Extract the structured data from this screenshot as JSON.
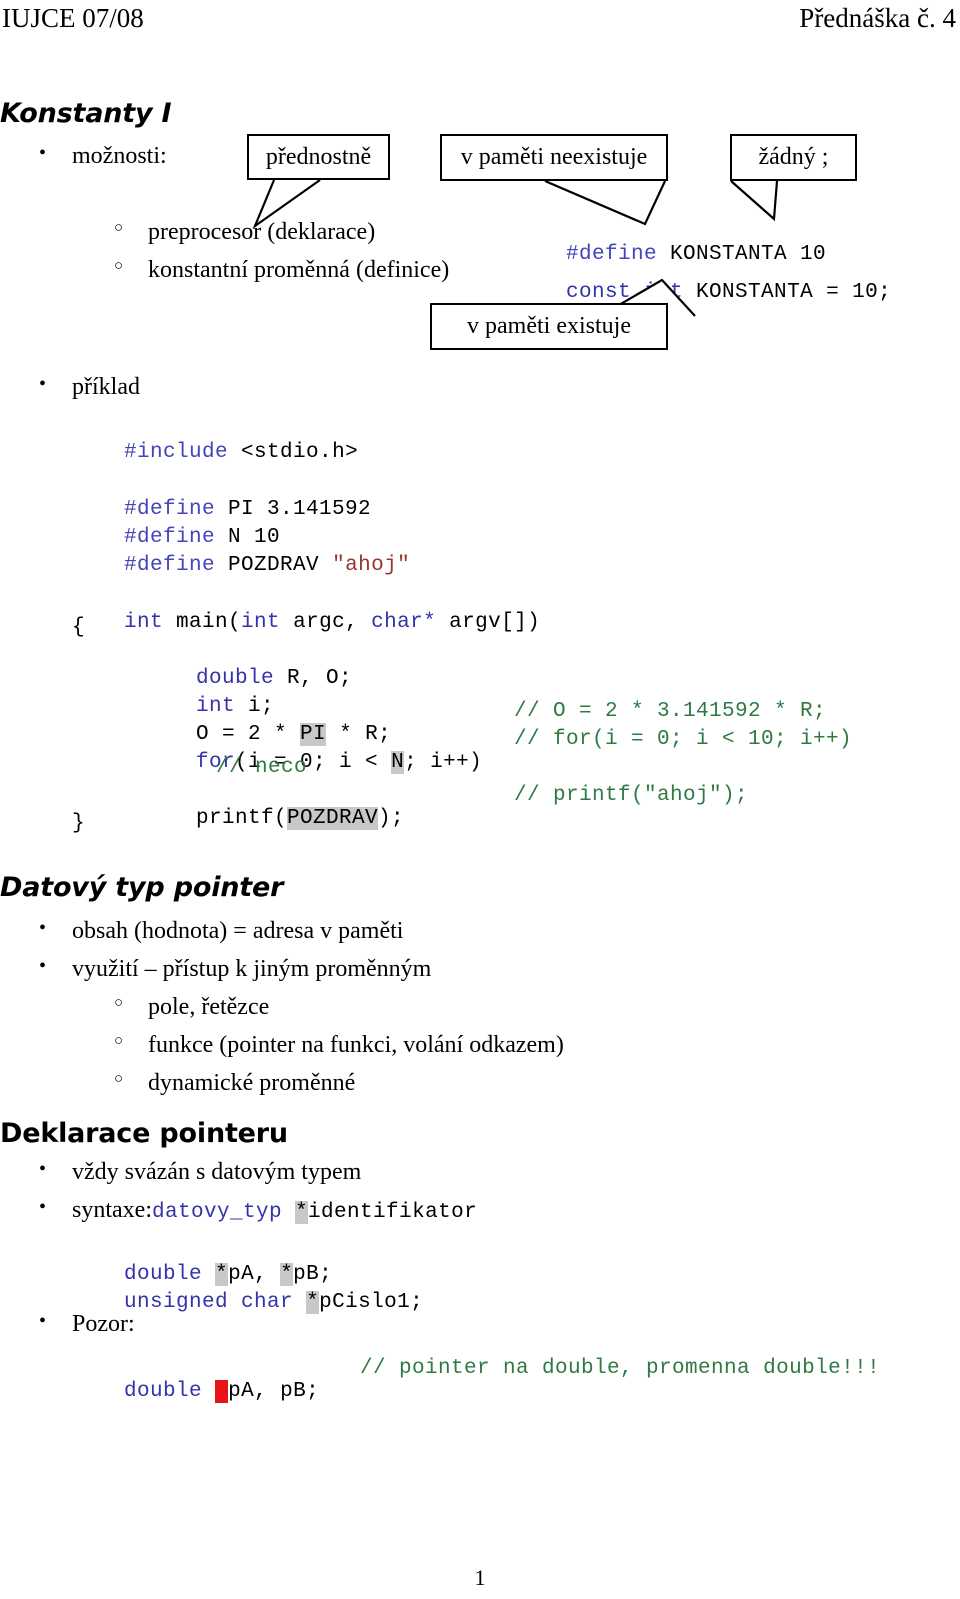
{
  "header": {
    "left": "IUJCE 07/08",
    "right": "Přednáška č. 4"
  },
  "sections": {
    "konstanty": "Konstanty I",
    "pointer": "Datový typ pointer",
    "deklarace": "Deklarace pointeru"
  },
  "konstanty": {
    "moznosti_label": "možnosti:",
    "items": [
      {
        "text": "preprocesor (deklarace)"
      },
      {
        "text": "konstantní proměnná (definice)"
      }
    ],
    "code": {
      "define_kw": "#define",
      "define_rest": " KONSTANTA 10",
      "const_kw": "const int",
      "const_rest": " KONSTANTA = 10;"
    },
    "callouts": [
      {
        "id": "prednostne",
        "text": "přednostně"
      },
      {
        "id": "neexistuje",
        "text": "v paměti neexistuje"
      },
      {
        "id": "zadny",
        "text": "žádný ;"
      },
      {
        "id": "existuje",
        "text": "v paměti existuje"
      }
    ],
    "priklad_label": "příklad"
  },
  "example_code": {
    "include": {
      "pp": "#include",
      "rest": " <stdio.h>"
    },
    "define_pi": {
      "pp": "#define",
      "rest": " PI 3.141592"
    },
    "define_n": {
      "pp": "#define",
      "rest": " N 10"
    },
    "define_pozdrav": {
      "pp": "#define",
      "mid": " POZDRAV ",
      "str": "\"ahoj\""
    },
    "main_sig": {
      "kw1": "int",
      "mid1": " main(",
      "kw2": "int",
      "mid2": " argc, ",
      "kw3": "char*",
      "mid3": " argv[])"
    },
    "brace_open": "{",
    "double_decl": {
      "kw": "double",
      "rest": " R, O;"
    },
    "int_decl": {
      "kw": "int",
      "rest": " i;"
    },
    "o_assign": {
      "pre": "O = 2 * ",
      "hl": "PI",
      "post": " * R;"
    },
    "for_line": {
      "kw": "for",
      "pre": "(i = 0; i < ",
      "hl": "N",
      "post": "; i++)"
    },
    "neco_comment": "// neco",
    "printf_line": {
      "pre": "printf(",
      "hl": "POZDRAV",
      "post": ");"
    },
    "brace_close": "}",
    "comments": {
      "o_assign": "// O = 2 * 3.141592 * R;",
      "for_line": "// for(i = 0; i < 10; i++)",
      "printf_line": "// printf(\"ahoj\");"
    }
  },
  "pointer": {
    "items": [
      {
        "text": "obsah (hodnota) = adresa v paměti"
      },
      {
        "text": "využití – přístup k jiným proměnným"
      }
    ],
    "subitems": [
      {
        "text": "pole, řetězce"
      },
      {
        "text": "funkce (pointer na funkci, volání odkazem)"
      },
      {
        "text": "dynamické proměnné"
      }
    ]
  },
  "deklarace": {
    "items": [
      {
        "text": "vždy svázán s datovým typem"
      }
    ],
    "syntaxe_label": "syntaxe:",
    "syntaxe_code": {
      "kw": "datovy_typ",
      "space": " ",
      "star": "*",
      "rest": "identifikator"
    },
    "decl_double": {
      "kw": "double",
      "sp1": " ",
      "star1": "*",
      "mid": "pA, ",
      "star2": "*",
      "rest": "pB;"
    },
    "decl_uchar": {
      "kw": "unsigned char",
      "sp": " ",
      "star": "*",
      "rest": "pCislo1;"
    },
    "pozor_label": "Pozor:",
    "pozor_code": {
      "kw": "double",
      "sp": " ",
      "star": "*",
      "rest": "pA, pB;"
    },
    "pozor_comment": "// pointer na double, promenna double!!!"
  },
  "footer": {
    "page_number": "1"
  },
  "colors": {
    "keyword": "#3333aa",
    "preprocessor": "#4444bb",
    "string": "#993333",
    "comment": "#2f7a43",
    "highlight_gray": "#c8c8c8",
    "highlight_red": "#e8141a"
  }
}
